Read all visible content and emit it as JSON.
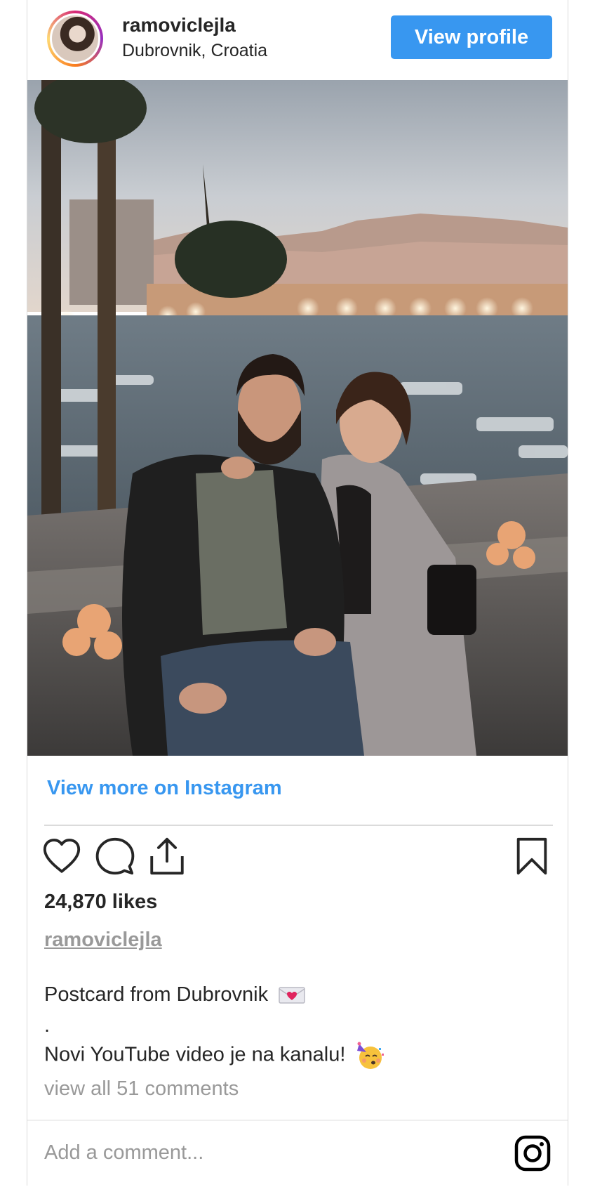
{
  "header": {
    "username": "ramoviclejla",
    "location": "Dubrovnik, Croatia",
    "view_profile_label": "View profile"
  },
  "post": {
    "image_description": "",
    "view_more_label": "View more on Instagram",
    "likes": "24,870 likes",
    "caption_username": "ramoviclejla",
    "caption_lines": [
      "Postcard from Dubrovnik",
      ".",
      "Novi YouTube video je na kanalu!"
    ],
    "caption_emojis": [
      "love-letter-emoji",
      "partying-face-emoji"
    ],
    "view_comments_label": "view all 51 comments"
  },
  "comment_box": {
    "placeholder": "Add a comment..."
  },
  "icons": {
    "like": "heart-icon",
    "comment": "comment-bubble-icon",
    "share": "share-icon",
    "save": "bookmark-icon",
    "brand": "instagram-icon"
  },
  "colors": {
    "accent": "#3897f0",
    "text": "#262626",
    "muted": "#999999",
    "border": "#dbdbdb"
  }
}
